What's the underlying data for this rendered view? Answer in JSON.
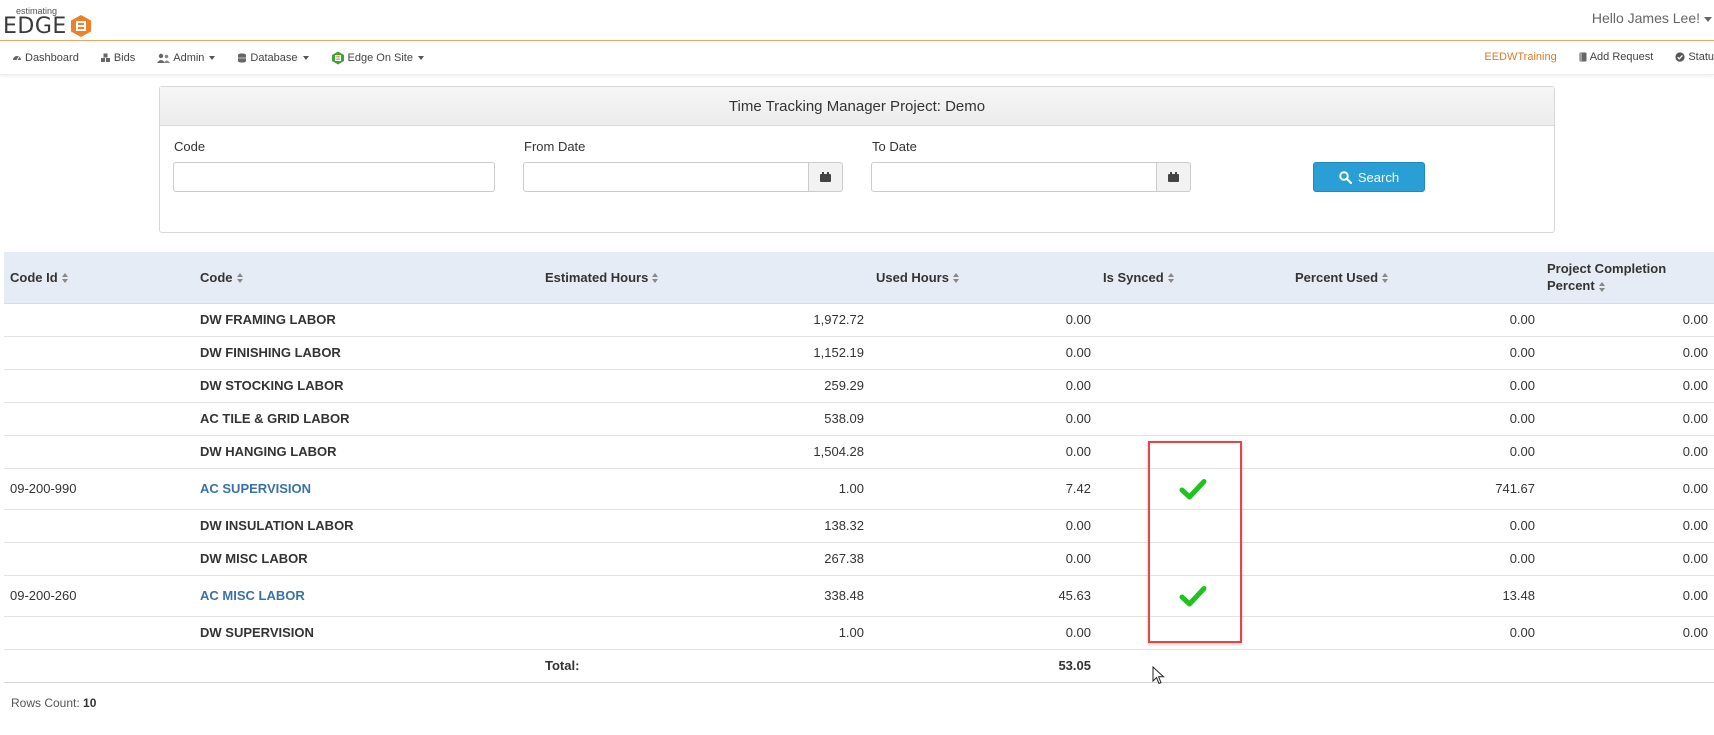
{
  "header": {
    "logo_small": "estimating",
    "logo_main": "EDGE",
    "greeting": "Hello James Lee!"
  },
  "nav": {
    "left": [
      {
        "label": "Dashboard",
        "icon": "dashboard-icon",
        "dropdown": false
      },
      {
        "label": "Bids",
        "icon": "cubes-icon",
        "dropdown": false
      },
      {
        "label": "Admin",
        "icon": "users-icon",
        "dropdown": true
      },
      {
        "label": "Database",
        "icon": "database-icon",
        "dropdown": true
      },
      {
        "label": "Edge On Site",
        "icon": "edge-logo-icon",
        "dropdown": true
      }
    ],
    "right": [
      {
        "label": "EEDWTraining",
        "icon": null
      },
      {
        "label": "Add Request",
        "icon": "book-icon"
      },
      {
        "label": "Statu",
        "icon": "check-circle-icon"
      }
    ]
  },
  "panel": {
    "title": "Time Tracking Manager Project: Demo",
    "code_label": "Code",
    "code_value": "",
    "from_label": "From Date",
    "from_value": "",
    "to_label": "To Date",
    "to_value": "",
    "search_label": "Search"
  },
  "table": {
    "columns": [
      "Code Id",
      "Code",
      "Estimated Hours",
      "Used Hours",
      "Is Synced",
      "Percent Used",
      "Project Completion Percent"
    ],
    "rows": [
      {
        "code_id": "",
        "code": "DW FRAMING LABOR",
        "estimated": "1,972.72",
        "used": "0.00",
        "synced": false,
        "percent_used": "0.00",
        "completion": "0.00",
        "link": false
      },
      {
        "code_id": "",
        "code": "DW FINISHING LABOR",
        "estimated": "1,152.19",
        "used": "0.00",
        "synced": false,
        "percent_used": "0.00",
        "completion": "0.00",
        "link": false
      },
      {
        "code_id": "",
        "code": "DW STOCKING LABOR",
        "estimated": "259.29",
        "used": "0.00",
        "synced": false,
        "percent_used": "0.00",
        "completion": "0.00",
        "link": false
      },
      {
        "code_id": "",
        "code": "AC TILE & GRID LABOR",
        "estimated": "538.09",
        "used": "0.00",
        "synced": false,
        "percent_used": "0.00",
        "completion": "0.00",
        "link": false
      },
      {
        "code_id": "",
        "code": "DW HANGING LABOR",
        "estimated": "1,504.28",
        "used": "0.00",
        "synced": false,
        "percent_used": "0.00",
        "completion": "0.00",
        "link": false
      },
      {
        "code_id": "09-200-990",
        "code": "AC SUPERVISION",
        "estimated": "1.00",
        "used": "7.42",
        "synced": true,
        "percent_used": "741.67",
        "completion": "0.00",
        "link": true
      },
      {
        "code_id": "",
        "code": "DW INSULATION LABOR",
        "estimated": "138.32",
        "used": "0.00",
        "synced": false,
        "percent_used": "0.00",
        "completion": "0.00",
        "link": false
      },
      {
        "code_id": "",
        "code": "DW MISC LABOR",
        "estimated": "267.38",
        "used": "0.00",
        "synced": false,
        "percent_used": "0.00",
        "completion": "0.00",
        "link": false
      },
      {
        "code_id": "09-200-260",
        "code": "AC MISC LABOR",
        "estimated": "338.48",
        "used": "45.63",
        "synced": true,
        "percent_used": "13.48",
        "completion": "0.00",
        "link": true
      },
      {
        "code_id": "",
        "code": "DW SUPERVISION",
        "estimated": "1.00",
        "used": "0.00",
        "synced": false,
        "percent_used": "0.00",
        "completion": "0.00",
        "link": false
      }
    ],
    "total_label": "Total:",
    "total_used": "53.05"
  },
  "footer": {
    "rows_count_label": "Rows Count:",
    "rows_count": "10"
  },
  "colors": {
    "accent_orange": "#e07a25",
    "search_blue": "#2a9fd6",
    "link_blue": "#3a72a8",
    "check_green": "#1ec41e",
    "highlight_red": "#e0464a",
    "header_bg": "#e6ecf5"
  }
}
